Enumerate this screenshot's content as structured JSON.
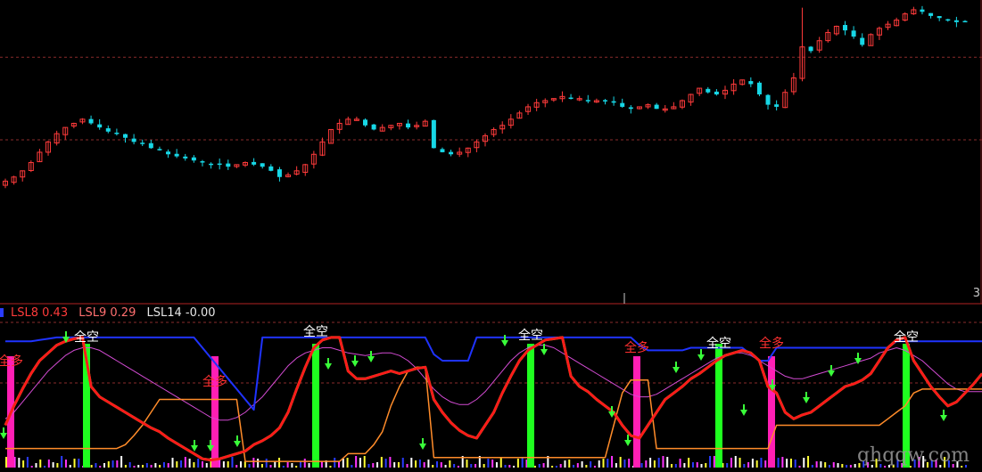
{
  "axis_tag": "3",
  "watermark": "qhqqw.com",
  "legend": [
    {
      "label": "LSL8",
      "value": "0.43",
      "color": "#ff3b3b"
    },
    {
      "label": "LSL9",
      "value": "0.29",
      "color": "#ff6f6f"
    },
    {
      "label": "LSL14",
      "value": "-0.00",
      "color": "#e6e6e6"
    }
  ],
  "signals": {
    "long_label": "全多",
    "short_label": "全空"
  },
  "colors": {
    "up": "#ff3b3b",
    "down": "#17d7e6",
    "grid": "#8a2b2b",
    "divider": "#b22222",
    "red_line": "#ff1a1a",
    "green_line": "#30ff30",
    "blue_line": "#1f33ff",
    "orange_line": "#ff8c2a",
    "magenta_line": "#d24bd2",
    "long_bar": "#ff1fb4",
    "short_bar": "#1fff1f",
    "long_text": "#ff3030",
    "short_text": "#ffffff",
    "arrow": "#39ff39"
  },
  "chart_data": [
    {
      "type": "candlestick",
      "title": "",
      "close": [
        10.0,
        10.2,
        10.5,
        10.9,
        11.4,
        11.9,
        12.3,
        12.6,
        12.8,
        13.0,
        12.8,
        12.6,
        12.4,
        12.3,
        12.1,
        11.9,
        11.8,
        11.6,
        11.5,
        11.3,
        11.2,
        11.1,
        11.0,
        10.9,
        10.8,
        10.8,
        10.7,
        10.8,
        10.9,
        10.8,
        10.7,
        10.5,
        10.2,
        10.3,
        10.5,
        10.8,
        11.3,
        11.9,
        12.5,
        12.8,
        13.0,
        13.0,
        12.7,
        12.5,
        12.6,
        12.7,
        12.8,
        12.6,
        12.7,
        12.9,
        11.6,
        11.4,
        11.3,
        11.4,
        11.6,
        11.9,
        12.2,
        12.5,
        12.7,
        13.0,
        13.3,
        13.6,
        13.8,
        13.9,
        14.0,
        14.1,
        14.0,
        14.0,
        13.9,
        13.9,
        13.9,
        13.8,
        13.6,
        13.5,
        13.6,
        13.7,
        13.5,
        13.5,
        13.6,
        13.9,
        14.2,
        14.5,
        14.3,
        14.2,
        14.4,
        14.7,
        14.9,
        14.7,
        14.2,
        13.7,
        13.6,
        14.3,
        15.0,
        16.5,
        16.3,
        16.8,
        17.2,
        17.5,
        17.3,
        17.0,
        16.6,
        17.1,
        17.4,
        17.6,
        17.8,
        18.1,
        18.3,
        18.2,
        18.0,
        17.9,
        17.8,
        17.7,
        17.7
      ],
      "up_color": "#ff3b3b",
      "down_color": "#17d7e6",
      "grid_levels": [
        12.0,
        16.0
      ]
    },
    {
      "type": "line",
      "title": "",
      "x": [
        0,
        1,
        2,
        3,
        4,
        5,
        6,
        7,
        8,
        9,
        10,
        11,
        12,
        13,
        14,
        15,
        16,
        17,
        18,
        19,
        20,
        21,
        22,
        23,
        24,
        25,
        26,
        27,
        28,
        29,
        30,
        31,
        32,
        33,
        34,
        35,
        36,
        37,
        38,
        39,
        40,
        41,
        42,
        43,
        44,
        45,
        46,
        47,
        48,
        49,
        50,
        51,
        52,
        53,
        54,
        55,
        56,
        57,
        58,
        59,
        60,
        61,
        62,
        63,
        64,
        65,
        66,
        67,
        68,
        69,
        70,
        71,
        72,
        73,
        74,
        75,
        76,
        77,
        78,
        79,
        80,
        81,
        82,
        83,
        84,
        85,
        86,
        87,
        88,
        89,
        90,
        91,
        92,
        93,
        94,
        95,
        96,
        97,
        98,
        99,
        100,
        101,
        102,
        103,
        104,
        105,
        106,
        107,
        108,
        109,
        110,
        111,
        112
      ],
      "ylim": [
        0,
        100
      ],
      "series": [
        {
          "color": "#ff1a1a",
          "values": [
            30,
            45,
            58,
            70,
            80,
            86,
            92,
            95,
            97,
            98,
            60,
            52,
            48,
            44,
            40,
            36,
            32,
            28,
            25,
            20,
            16,
            12,
            8,
            4,
            3,
            4,
            6,
            8,
            10,
            15,
            18,
            22,
            28,
            40,
            58,
            75,
            90,
            96,
            98,
            98,
            72,
            66,
            66,
            68,
            70,
            72,
            70,
            72,
            74,
            75,
            50,
            40,
            32,
            26,
            22,
            20,
            30,
            40,
            55,
            68,
            80,
            88,
            92,
            96,
            97,
            98,
            68,
            60,
            56,
            50,
            45,
            40,
            30,
            22,
            20,
            30,
            40,
            50,
            55,
            60,
            66,
            70,
            75,
            80,
            84,
            86,
            88,
            86,
            80,
            60,
            55,
            40,
            35,
            38,
            40,
            45,
            50,
            55,
            60,
            62,
            65,
            70,
            80,
            90,
            96,
            98,
            80,
            70,
            60,
            52,
            45,
            48,
            55,
            62,
            70
          ]
        },
        {
          "color": "#30ff30",
          "values": [
            30,
            45,
            58,
            70,
            80,
            86,
            92,
            95,
            97,
            98,
            60,
            52,
            48,
            44,
            40,
            36,
            32,
            28,
            25,
            20,
            16,
            12,
            8,
            4,
            3,
            4,
            6,
            8,
            10,
            15,
            18,
            22,
            28,
            40,
            58,
            75,
            90,
            96,
            98,
            98,
            72,
            66,
            66,
            68,
            70,
            72,
            70,
            72,
            74,
            75,
            50,
            40,
            32,
            26,
            22,
            20,
            30,
            40,
            55,
            68,
            80,
            88,
            92,
            96,
            97,
            98,
            68,
            60,
            56,
            50,
            45,
            40,
            30,
            22,
            20,
            30,
            40,
            50,
            55,
            60,
            66,
            70,
            75,
            80,
            84,
            86,
            88,
            86,
            80,
            60,
            55,
            40,
            35,
            38,
            40,
            45,
            50,
            55,
            60,
            62,
            65,
            70,
            80,
            90,
            96,
            98,
            80,
            70,
            60,
            52,
            45,
            48,
            55,
            62,
            70
          ]
        },
        {
          "color": "#1f33ff",
          "values": [
            95,
            95,
            95,
            95,
            96,
            97,
            98,
            98,
            98,
            98,
            98,
            98,
            98,
            98,
            98,
            98,
            98,
            98,
            98,
            98,
            98,
            98,
            98,
            90,
            82,
            74,
            66,
            58,
            50,
            42,
            98,
            98,
            98,
            98,
            98,
            98,
            98,
            98,
            98,
            98,
            98,
            98,
            98,
            98,
            98,
            98,
            98,
            98,
            98,
            98,
            85,
            80,
            80,
            80,
            80,
            98,
            98,
            98,
            98,
            98,
            98,
            98,
            98,
            98,
            98,
            98,
            98,
            98,
            98,
            98,
            98,
            98,
            98,
            98,
            92,
            88,
            88,
            88,
            88,
            88,
            90,
            90,
            90,
            90,
            90,
            90,
            90,
            85,
            80,
            80,
            90,
            90,
            90,
            90,
            90,
            90,
            90,
            90,
            90,
            90,
            90,
            90,
            90,
            90,
            95,
            95,
            95,
            95,
            95,
            95,
            95,
            95,
            95,
            95,
            95
          ]
        },
        {
          "color": "#ff8c2a",
          "values": [
            12,
            12,
            12,
            12,
            12,
            12,
            12,
            12,
            12,
            12,
            12,
            12,
            12,
            12,
            15,
            22,
            30,
            40,
            50,
            50,
            50,
            50,
            50,
            50,
            50,
            50,
            50,
            50,
            2,
            2,
            2,
            2,
            2,
            2,
            2,
            2,
            2,
            2,
            2,
            2,
            8,
            8,
            8,
            15,
            25,
            45,
            60,
            72,
            75,
            75,
            5,
            5,
            5,
            5,
            5,
            5,
            5,
            5,
            5,
            5,
            5,
            5,
            5,
            5,
            5,
            5,
            5,
            5,
            5,
            5,
            5,
            30,
            55,
            65,
            65,
            65,
            12,
            12,
            12,
            12,
            12,
            12,
            12,
            12,
            12,
            12,
            12,
            12,
            12,
            12,
            30,
            30,
            30,
            30,
            30,
            30,
            30,
            30,
            30,
            30,
            30,
            30,
            30,
            35,
            40,
            45,
            55,
            58,
            58,
            58,
            58,
            58,
            58,
            58,
            58
          ]
        },
        {
          "color": "#d24bd2",
          "values": [
            35,
            40,
            48,
            56,
            64,
            72,
            78,
            84,
            88,
            90,
            90,
            88,
            84,
            80,
            76,
            72,
            68,
            64,
            60,
            56,
            52,
            48,
            44,
            40,
            36,
            34,
            34,
            36,
            40,
            46,
            52,
            60,
            68,
            76,
            82,
            86,
            88,
            90,
            90,
            88,
            86,
            85,
            84,
            85,
            86,
            86,
            84,
            80,
            74,
            66,
            58,
            52,
            48,
            46,
            46,
            50,
            56,
            64,
            72,
            80,
            86,
            90,
            92,
            92,
            90,
            86,
            82,
            78,
            74,
            70,
            66,
            62,
            58,
            54,
            52,
            52,
            54,
            58,
            62,
            66,
            70,
            74,
            78,
            82,
            84,
            86,
            86,
            84,
            80,
            76,
            72,
            68,
            66,
            66,
            68,
            70,
            72,
            74,
            76,
            78,
            80,
            82,
            86,
            88,
            90,
            88,
            84,
            80,
            74,
            68,
            62,
            58,
            56,
            56,
            56
          ]
        }
      ]
    }
  ]
}
